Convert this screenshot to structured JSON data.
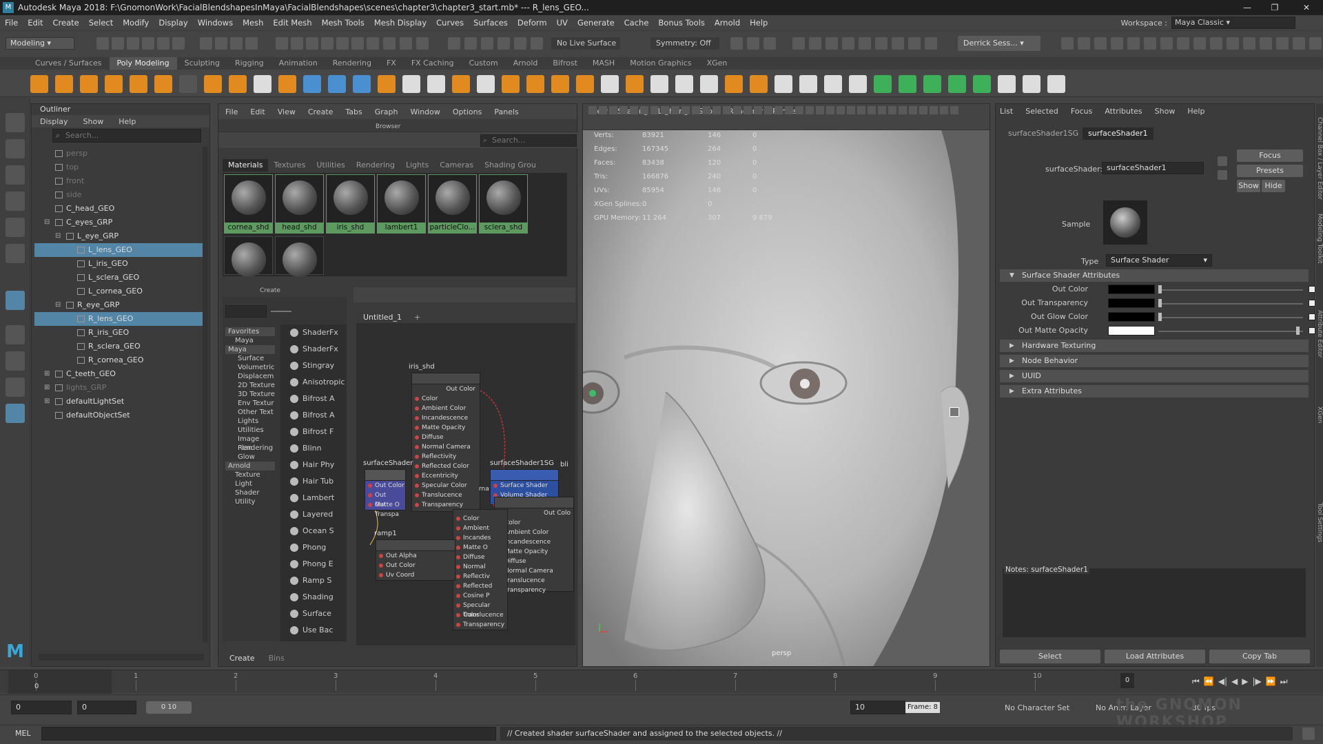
{
  "window": {
    "title": "Autodesk Maya 2018: F:\\GnomonWork\\FacialBlendshapesInMaya\\FacialBlendshapes\\scenes\\chapter3\\chapter3_start.mb*  ---  R_lens_GEO..."
  },
  "menubar": [
    "File",
    "Edit",
    "Create",
    "Select",
    "Modify",
    "Display",
    "Windows",
    "Mesh",
    "Edit Mesh",
    "Mesh Tools",
    "Mesh Display",
    "Curves",
    "Surfaces",
    "Deform",
    "UV",
    "Generate",
    "Cache",
    "Bonus Tools",
    "Arnold",
    "Help"
  ],
  "workspace": {
    "label": "Workspace :",
    "value": "Maya Classic"
  },
  "statusline": {
    "mode": "Modeling",
    "live_surface": "No Live Surface",
    "symmetry": "Symmetry: Off",
    "user": "Derrick Sess..."
  },
  "shelf_tabs": [
    "Curves / Surfaces",
    "Poly Modeling",
    "Sculpting",
    "Rigging",
    "Animation",
    "Rendering",
    "FX",
    "FX Caching",
    "Custom",
    "Arnold",
    "Bifrost",
    "MASH",
    "Motion Graphics",
    "XGen"
  ],
  "shelf_active": "Poly Modeling",
  "outliner": {
    "title": "Outliner",
    "menu": [
      "Display",
      "Show",
      "Help"
    ],
    "search_placeholder": "Search...",
    "items": [
      {
        "label": "persp",
        "indent": 0,
        "dim": true,
        "sel": false,
        "exp": ""
      },
      {
        "label": "top",
        "indent": 0,
        "dim": true,
        "sel": false,
        "exp": ""
      },
      {
        "label": "front",
        "indent": 0,
        "dim": true,
        "sel": false,
        "exp": ""
      },
      {
        "label": "side",
        "indent": 0,
        "dim": true,
        "sel": false,
        "exp": ""
      },
      {
        "label": "C_head_GEO",
        "indent": 0,
        "dim": false,
        "sel": false,
        "exp": ""
      },
      {
        "label": "C_eyes_GRP",
        "indent": 0,
        "dim": false,
        "sel": false,
        "exp": "-"
      },
      {
        "label": "L_eye_GRP",
        "indent": 1,
        "dim": false,
        "sel": false,
        "exp": "-"
      },
      {
        "label": "L_lens_GEO",
        "indent": 2,
        "dim": false,
        "sel": true,
        "exp": ""
      },
      {
        "label": "L_iris_GEO",
        "indent": 2,
        "dim": false,
        "sel": false,
        "exp": ""
      },
      {
        "label": "L_sclera_GEO",
        "indent": 2,
        "dim": false,
        "sel": false,
        "exp": ""
      },
      {
        "label": "L_cornea_GEO",
        "indent": 2,
        "dim": false,
        "sel": false,
        "exp": ""
      },
      {
        "label": "R_eye_GRP",
        "indent": 1,
        "dim": false,
        "sel": false,
        "exp": "-"
      },
      {
        "label": "R_lens_GEO",
        "indent": 2,
        "dim": false,
        "sel": true,
        "exp": ""
      },
      {
        "label": "R_iris_GEO",
        "indent": 2,
        "dim": false,
        "sel": false,
        "exp": ""
      },
      {
        "label": "R_sclera_GEO",
        "indent": 2,
        "dim": false,
        "sel": false,
        "exp": ""
      },
      {
        "label": "R_cornea_GEO",
        "indent": 2,
        "dim": false,
        "sel": false,
        "exp": ""
      },
      {
        "label": "C_teeth_GEO",
        "indent": 0,
        "dim": false,
        "sel": false,
        "exp": "+"
      },
      {
        "label": "lights_GRP",
        "indent": 0,
        "dim": true,
        "sel": false,
        "exp": "+"
      },
      {
        "label": "defaultLightSet",
        "indent": 0,
        "dim": false,
        "sel": false,
        "exp": "+"
      },
      {
        "label": "defaultObjectSet",
        "indent": 0,
        "dim": false,
        "sel": false,
        "exp": ""
      }
    ]
  },
  "hypershade": {
    "menu": [
      "File",
      "Edit",
      "View",
      "Create",
      "Tabs",
      "Graph",
      "Window",
      "Options",
      "Panels"
    ],
    "browser_label": "Browser",
    "search_placeholder": "Search...",
    "tabs": [
      "Materials",
      "Textures",
      "Utilities",
      "Rendering",
      "Lights",
      "Cameras",
      "Shading Grou"
    ],
    "materials": [
      "cornea_shd",
      "head_shd",
      "iris_shd",
      "lambert1",
      "particleClo...",
      "sclera_shd"
    ],
    "create_label": "Create",
    "create_tree": [
      "Favorites",
      "Maya",
      "Maya",
      "Surface",
      "Volumetric",
      "Displacem",
      "2D Texture",
      "3D Texture",
      "Env Textur",
      "Other Text",
      "Lights",
      "Utilities",
      "Image Plan",
      "Rendering",
      "Glow",
      "Arnold",
      "Texture",
      "Light",
      "Shader",
      "Utility"
    ],
    "create_items": [
      "ShaderFx",
      "ShaderFx",
      "Stingray",
      "Anisotropic",
      "Bifrost A",
      "Bifrost A",
      "Bifrost F",
      "Blinn",
      "Hair Phy",
      "Hair Tub",
      "Lambert",
      "Layered",
      "Ocean S",
      "Phong",
      "Phong E",
      "Ramp S",
      "Shading",
      "Surface",
      "Use Bac"
    ],
    "bottom_tabs": [
      "Create",
      "Bins"
    ],
    "graph_tab": "Untitled_1",
    "graph_plus": "+",
    "nodes": {
      "iris": {
        "title": "iris_shd",
        "out": "Out Color",
        "attrs": [
          "Color",
          "Ambient Color",
          "Incandescence",
          "Matte Opacity",
          "Diffuse",
          "Normal Camera",
          "Reflectivity",
          "Reflected Color",
          "Eccentricity",
          "Specular Color",
          "Translucence",
          "Transparency"
        ]
      },
      "surf": {
        "title": "surfaceShader",
        "attrs": [
          "Out Color",
          "Out Matte O",
          "Out Transpa"
        ]
      },
      "sg": {
        "title": "surfaceShader1SG",
        "attrs": [
          "Surface Shader",
          "Volume Shader",
          "Displacement"
        ]
      },
      "ramp": {
        "title": "ramp1",
        "attrs": [
          "Out Alpha",
          "Out Color",
          "Uv Coord"
        ]
      },
      "lower": {
        "out": "Out Colo",
        "attrs": [
          "Color",
          "Ambient Color",
          "Incandescence",
          "Matte Opacity",
          "Diffuse",
          "Normal Camera",
          "Translucence",
          "Transparency"
        ]
      },
      "lower2": {
        "attrs": [
          "Color",
          "Ambient",
          "Incandes",
          "Matte O",
          "Diffuse",
          "Normal",
          "Reflectiv",
          "Reflected",
          "Cosine P",
          "Specular Color",
          "Translucence",
          "Transparency"
        ]
      },
      "partial": {
        "title": "bli",
        "cut": "rna"
      }
    }
  },
  "viewport": {
    "menu": [
      "View",
      "Shading",
      "Lighting",
      "Show",
      "Renderer",
      "Panels"
    ],
    "camera": "persp",
    "hud": [
      {
        "label": "Verts:",
        "a": "83921",
        "b": "146",
        "c": "0"
      },
      {
        "label": "Edges:",
        "a": "167345",
        "b": "264",
        "c": "0"
      },
      {
        "label": "Faces:",
        "a": "83438",
        "b": "120",
        "c": "0"
      },
      {
        "label": "Tris:",
        "a": "166876",
        "b": "240",
        "c": "0"
      },
      {
        "label": "UVs:",
        "a": "85954",
        "b": "146",
        "c": "0"
      },
      {
        "label": "XGen Splines:",
        "a": "0",
        "b": "0",
        "c": ""
      },
      {
        "label": "GPU Memory:",
        "a": "11 264",
        "b": "307",
        "c": "9 679"
      }
    ]
  },
  "attribute_editor": {
    "menu": [
      "List",
      "Selected",
      "Focus",
      "Attributes",
      "Show",
      "Help"
    ],
    "tabs": [
      "surfaceShader1SG",
      "surfaceShader1"
    ],
    "node_label": "surfaceShader:",
    "node_value": "surfaceShader1",
    "buttons": [
      "Focus",
      "Presets",
      "Show",
      "Hide"
    ],
    "sample_label": "Sample",
    "type_label": "Type",
    "type_value": "Surface Shader",
    "section_open": "Surface Shader Attributes",
    "attrs": [
      {
        "label": "Out Color",
        "color": "#000000",
        "level": 0
      },
      {
        "label": "Out Transparency",
        "color": "#000000",
        "level": 0
      },
      {
        "label": "Out Glow Color",
        "color": "#000000",
        "level": 0
      },
      {
        "label": "Out Matte Opacity",
        "color": "#ffffff",
        "level": 1
      }
    ],
    "sections_closed": [
      "Hardware Texturing",
      "Node Behavior",
      "UUID",
      "Extra Attributes"
    ],
    "notes": "Notes:  surfaceShader1",
    "bottom_buttons": [
      "Select",
      "Load Attributes",
      "Copy Tab"
    ]
  },
  "side_tabs": [
    "Channel Box / Layer Editor",
    "Modeling Toolkit",
    "Attribute Editor",
    "XGen",
    "Tool Settings"
  ],
  "timeline": {
    "ticks": [
      "0",
      "1",
      "2",
      "3",
      "4",
      "5",
      "6",
      "7",
      "8",
      "9",
      "10"
    ],
    "current": "0",
    "current_right": "0"
  },
  "range": {
    "start": "0",
    "start2": "0",
    "slider": "0 10",
    "end": "10",
    "frame": "Frame: 8",
    "character_set": "No Character Set",
    "anim_layer": "No Anim Layer",
    "fps": "30 fps"
  },
  "cmdline": {
    "lang": "MEL",
    "message": "// Created shader surfaceShader and assigned to the selected objects. //"
  },
  "watermark": "the GNOMON WORKSHOP"
}
